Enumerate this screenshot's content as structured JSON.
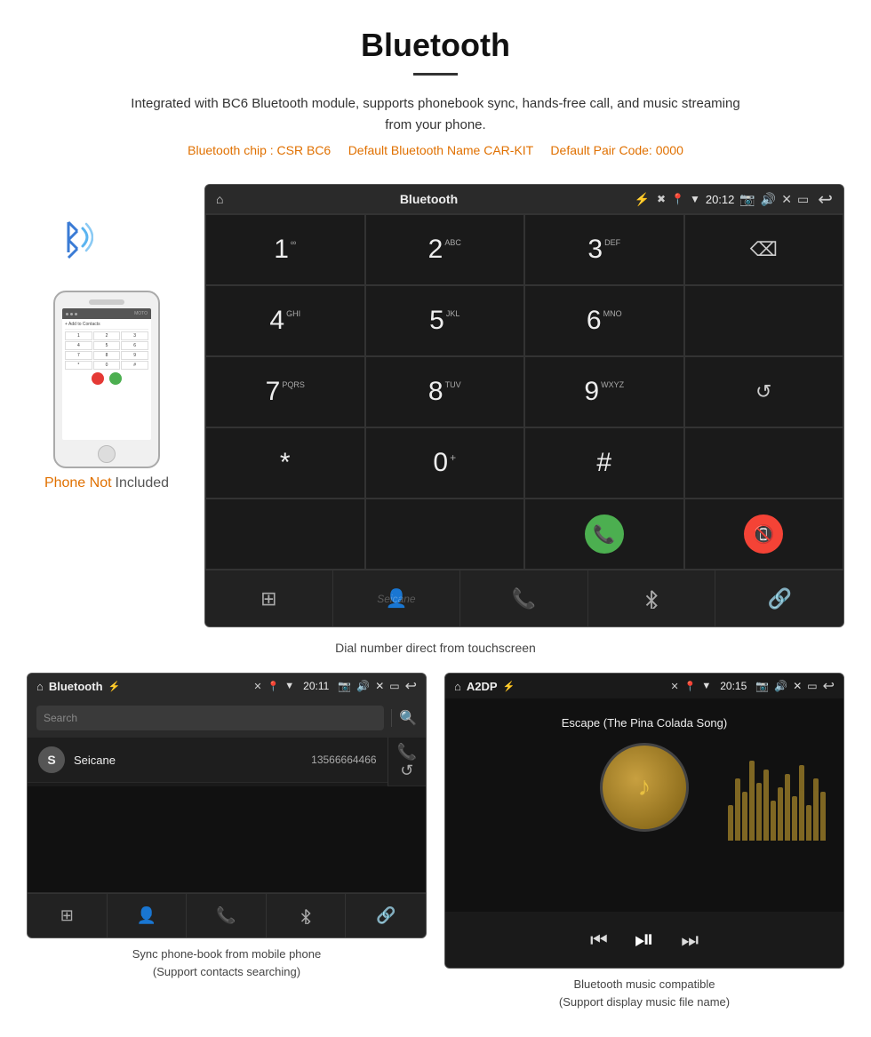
{
  "header": {
    "title": "Bluetooth",
    "subtitle": "Integrated with BC6 Bluetooth module, supports phonebook sync, hands-free call, and music streaming from your phone.",
    "spec_bluetooth_chip": "Bluetooth chip : CSR BC6",
    "spec_bt_name": "Default Bluetooth Name CAR-KIT",
    "spec_pair_code": "Default Pair Code: 0000"
  },
  "phone_area": {
    "not_included_not": "Phone Not",
    "not_included_included": "Included"
  },
  "dial_screen": {
    "status_bar": {
      "title": "Bluetooth",
      "time": "20:12"
    },
    "keys": [
      {
        "num": "1",
        "sub": "∞"
      },
      {
        "num": "2",
        "sub": "ABC"
      },
      {
        "num": "3",
        "sub": "DEF"
      },
      {
        "num": "",
        "sub": ""
      },
      {
        "num": "4",
        "sub": "GHI"
      },
      {
        "num": "5",
        "sub": "JKL"
      },
      {
        "num": "6",
        "sub": "MNO"
      },
      {
        "num": "",
        "sub": ""
      },
      {
        "num": "7",
        "sub": "PQRS"
      },
      {
        "num": "8",
        "sub": "TUV"
      },
      {
        "num": "9",
        "sub": "WXYZ"
      },
      {
        "num": "",
        "sub": ""
      },
      {
        "num": "*",
        "sub": ""
      },
      {
        "num": "0",
        "sub": "+"
      },
      {
        "num": "#",
        "sub": ""
      },
      {
        "num": "",
        "sub": ""
      }
    ],
    "watermark": "Seicane"
  },
  "caption_dial": "Dial number direct from touchscreen",
  "phonebook_screen": {
    "status_bar": {
      "title": "Bluetooth",
      "time": "20:11"
    },
    "search_placeholder": "Search",
    "contact": {
      "initial": "S",
      "name": "Seicane",
      "number": "13566664466"
    }
  },
  "caption_phonebook_line1": "Sync phone-book from mobile phone",
  "caption_phonebook_line2": "(Support contacts searching)",
  "music_screen": {
    "status_bar": {
      "title": "A2DP",
      "time": "20:15"
    },
    "song_title": "Escape (The Pina Colada Song)"
  },
  "caption_music_line1": "Bluetooth music compatible",
  "caption_music_line2": "(Support display music file name)",
  "eq_bars": [
    40,
    70,
    55,
    90,
    65,
    80,
    45,
    60,
    75,
    50,
    85,
    40,
    70,
    55
  ]
}
